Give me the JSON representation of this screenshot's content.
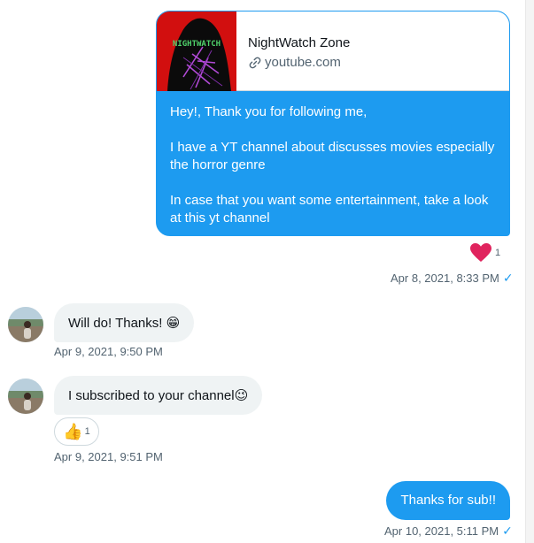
{
  "conversation": {
    "link_card": {
      "title": "NightWatch Zone",
      "domain": "youtube.com",
      "thumbnail_text": "NIGHTWATCH",
      "message_paragraphs": [
        "Hey!, Thank you for following me,",
        "I have a YT channel about discusses movies especially the horror genre",
        "In case that you want some entertainment, take a look at this yt channel"
      ],
      "reaction": {
        "icon": "heart-icon",
        "count": "1",
        "color": "#e0245e"
      },
      "timestamp": "Apr 8, 2021, 8:33 PM",
      "status_icon": "✓"
    },
    "incoming": [
      {
        "text": "Will do! Thanks!",
        "emoji": "😁",
        "timestamp": "Apr 9, 2021, 9:50 PM"
      },
      {
        "text": "I subscribed to your channel",
        "emoji": "😉",
        "reaction": {
          "icon": "thumbs-up-icon",
          "glyph": "👍",
          "count": "1"
        },
        "timestamp": "Apr 9, 2021, 9:51 PM"
      }
    ],
    "outgoing_last": {
      "text": "Thanks for sub!!",
      "timestamp": "Apr 10, 2021, 5:11 PM",
      "status_icon": "✓"
    }
  },
  "colors": {
    "accent": "#1d9bf0",
    "incoming_bubble": "#eff3f4",
    "muted_text": "#536471",
    "heart": "#e0245e"
  }
}
